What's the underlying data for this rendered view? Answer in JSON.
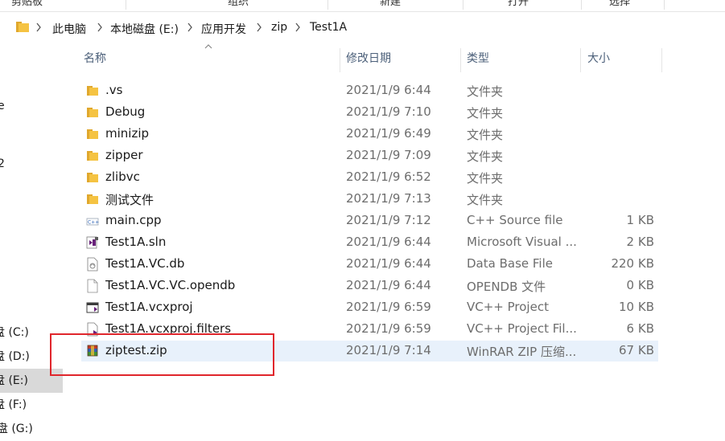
{
  "ribbon": {
    "groups": [
      "剪贴板",
      "组织",
      "新建",
      "打开",
      "选择"
    ]
  },
  "address": {
    "crumbs": [
      "此电脑",
      "本地磁盘 (E:)",
      "应用开发",
      "zip",
      "Test1A"
    ]
  },
  "nav": {
    "fragments": [
      "e",
      "2"
    ],
    "items": [
      {
        "label": "盘 (C:)"
      },
      {
        "label": "盘 (D:)"
      },
      {
        "label": "盘 (E:)",
        "selected": true
      },
      {
        "label": "盘 (F:)"
      },
      {
        "label": "l盘 (G:)"
      }
    ]
  },
  "columns": {
    "name": "名称",
    "date": "修改日期",
    "type": "类型",
    "size": "大小"
  },
  "files": [
    {
      "name": ".vs",
      "date": "2021/1/9 6:44",
      "type": "文件夹",
      "size": "",
      "icon": "folder-icon"
    },
    {
      "name": "Debug",
      "date": "2021/1/9 7:10",
      "type": "文件夹",
      "size": "",
      "icon": "folder-icon"
    },
    {
      "name": "minizip",
      "date": "2021/1/9 6:49",
      "type": "文件夹",
      "size": "",
      "icon": "folder-icon"
    },
    {
      "name": "zipper",
      "date": "2021/1/9 7:09",
      "type": "文件夹",
      "size": "",
      "icon": "folder-icon"
    },
    {
      "name": "zlibvc",
      "date": "2021/1/9 6:52",
      "type": "文件夹",
      "size": "",
      "icon": "folder-icon"
    },
    {
      "name": "测试文件",
      "date": "2021/1/9 7:13",
      "type": "文件夹",
      "size": "",
      "icon": "folder-icon"
    },
    {
      "name": "main.cpp",
      "date": "2021/1/9 7:12",
      "type": "C++ Source file",
      "size": "1 KB",
      "icon": "cpp-file-icon"
    },
    {
      "name": "Test1A.sln",
      "date": "2021/1/9 6:44",
      "type": "Microsoft Visual ...",
      "size": "2 KB",
      "icon": "solution-file-icon"
    },
    {
      "name": "Test1A.VC.db",
      "date": "2021/1/9 6:44",
      "type": "Data Base File",
      "size": "220 KB",
      "icon": "database-file-icon"
    },
    {
      "name": "Test1A.VC.VC.opendb",
      "date": "2021/1/9 6:44",
      "type": "OPENDB 文件",
      "size": "0 KB",
      "icon": "blank-file-icon"
    },
    {
      "name": "Test1A.vcxproj",
      "date": "2021/1/9 6:59",
      "type": "VC++ Project",
      "size": "10 KB",
      "icon": "project-file-icon"
    },
    {
      "name": "Test1A.vcxproj.filters",
      "date": "2021/1/9 6:59",
      "type": "VC++ Project Fil...",
      "size": "6 KB",
      "icon": "project-filters-file-icon"
    },
    {
      "name": "ziptest.zip",
      "date": "2021/1/9 7:14",
      "type": "WinRAR ZIP 压缩...",
      "size": "67 KB",
      "icon": "winrar-zip-icon",
      "selected": true
    }
  ],
  "colors": {
    "selection_bg": "#e8f1fb",
    "nav_selected_bg": "#d9d9d9",
    "header_text": "#4c607a",
    "annotation_box": "#e0262c",
    "folder": "#f5c342"
  }
}
